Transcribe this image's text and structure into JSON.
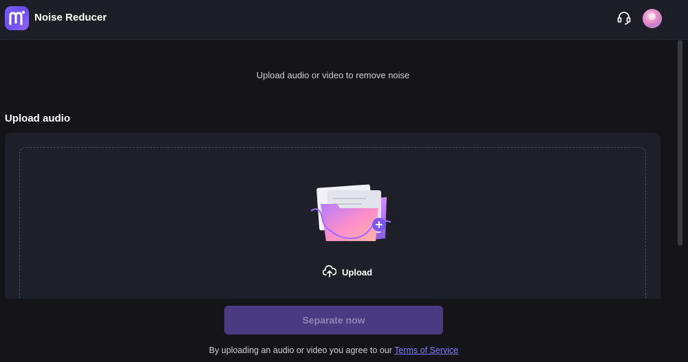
{
  "header": {
    "app_title": "Noise Reducer",
    "logo_icon": "m-logo-icon",
    "support_icon": "headset-icon",
    "avatar_icon": "user-avatar"
  },
  "main": {
    "subtitle": "Upload audio or video to remove noise",
    "section_title": "Upload audio",
    "upload_label": "Upload",
    "upload_icon": "cloud-upload-icon",
    "illustration_icon": "folder-add-icon"
  },
  "footer": {
    "separate_button": "Separate now",
    "agreement_text": "By uploading an audio or video you agree to our ",
    "tos_link": "Terms of Service"
  },
  "colors": {
    "accent": "#6a4cf2",
    "button_disabled": "#4a3a82",
    "link": "#8a7bff",
    "background": "#141419"
  }
}
